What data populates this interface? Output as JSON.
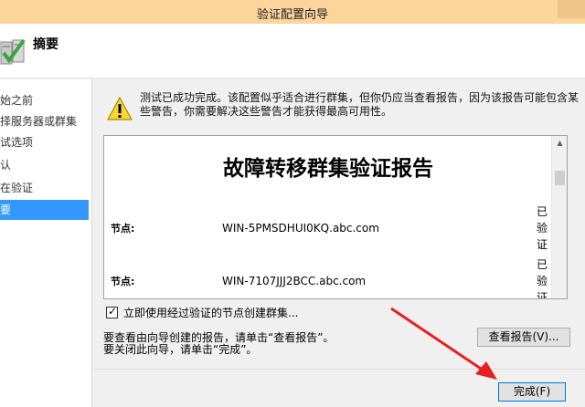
{
  "window": {
    "title": "验证配置向导"
  },
  "header": {
    "title": "摘要"
  },
  "sidebar": {
    "items": [
      {
        "label": "始之前"
      },
      {
        "label": "择服务器或群集"
      },
      {
        "label": "试选项"
      },
      {
        "label": "认"
      },
      {
        "label": "在验证"
      },
      {
        "label": "要"
      }
    ]
  },
  "summary": {
    "message": "测试已成功完成。该配置似乎适合进行群集，但你仍应当查看报告，因为该报告可能包含某些警告，你需要解决这些警告才能获得最高可用性。"
  },
  "report": {
    "title": "故障转移群集验证报告",
    "rows": [
      {
        "label": "节点:",
        "value": "WIN-5PMSDHUI0KQ.abc.com",
        "status": "已验证"
      },
      {
        "label": "节点:",
        "value": "WIN-7107JJJ2BCC.abc.com",
        "status": "已验证"
      }
    ]
  },
  "options": {
    "create_cluster_label": "立即使用经过验证的节点创建群集..."
  },
  "info": {
    "line1": "要查看由向导创建的报告，请单击“查看报告”。",
    "line2": "要关闭此向导，请单击“完成”。"
  },
  "buttons": {
    "view_report": "查看报告(V)...",
    "finish": "完成(F)"
  },
  "colors": {
    "titlebar": "#fcd49c",
    "selected": "#3399ff",
    "arrow": "#e8201f"
  }
}
